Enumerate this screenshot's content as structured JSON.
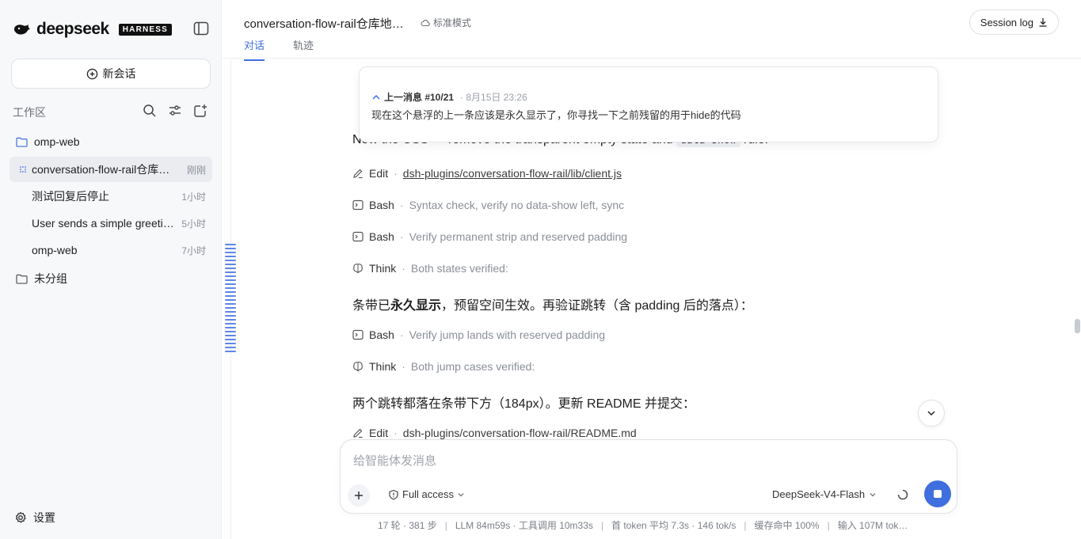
{
  "brand": {
    "name": "deepseek",
    "tag": "HARNESS"
  },
  "sidebar": {
    "new_chat": "新会话",
    "workspace_label": "工作区",
    "folders": [
      {
        "name": "omp-web"
      },
      {
        "name": "未分组"
      }
    ],
    "conversations": [
      {
        "title": "conversation-flow-rail仓库地址…",
        "time": "刚刚",
        "active": true
      },
      {
        "title": "测试回复后停止",
        "time": "1小时"
      },
      {
        "title": "User sends a simple greeti…",
        "time": "5小时"
      },
      {
        "title": "omp-web",
        "time": "7小时"
      }
    ],
    "settings": "设置"
  },
  "header": {
    "title": "conversation-flow-rail仓库地址…",
    "mode": "标准模式",
    "tabs": [
      {
        "label": "对话",
        "active": true
      },
      {
        "label": "轨迹"
      }
    ],
    "session_log": "Session log"
  },
  "prev_message": {
    "label": "上一消息 #10/21",
    "meta": "· 8月15日 23:26",
    "text": "现在这个悬浮的上一条应该是永久显示了，你寻找一下之前残留的用于hide的代码"
  },
  "feed": {
    "partial_text_a": "Now the CSS — remove the transparent empty state and ",
    "partial_code": "data-show",
    "partial_text_b": " rule:",
    "steps": [
      {
        "kind": "Edit",
        "icon": "pencil-icon",
        "target": "dsh-plugins/conversation-flow-rail/lib/client.js"
      },
      {
        "kind": "Bash",
        "icon": "terminal-icon",
        "desc": "Syntax check, verify no data-show left, sync"
      },
      {
        "kind": "Bash",
        "icon": "terminal-icon",
        "desc": "Verify permanent strip and reserved padding"
      },
      {
        "kind": "Think",
        "icon": "brain-icon",
        "desc": "Both states verified:"
      },
      {
        "kind": "Bash",
        "icon": "terminal-icon",
        "desc": "Verify jump lands with reserved padding"
      },
      {
        "kind": "Think",
        "icon": "brain-icon",
        "desc": "Both jump cases verified:"
      },
      {
        "kind": "Edit",
        "icon": "pencil-icon",
        "target": "dsh-plugins/conversation-flow-rail/README.md"
      }
    ],
    "para1_a": "条带已",
    "para1_b": "永久显示",
    "para1_c": "，预留空间生效。再验证跳转（含 padding 后的落点）：",
    "para2": "两个跳转都落在条带下方（184px）。更新 README 并提交："
  },
  "composer": {
    "placeholder": "给智能体发消息",
    "access": "Full access",
    "model": "DeepSeek-V4-Flash"
  },
  "stats": {
    "turns": "17 轮 · 381 步",
    "llm": "LLM 84m59s · 工具调用 10m33s",
    "first_token": "首 token 平均 7.3s · 146 tok/s",
    "cache": "缓存命中 100%",
    "input": "输入 107M tok…"
  }
}
